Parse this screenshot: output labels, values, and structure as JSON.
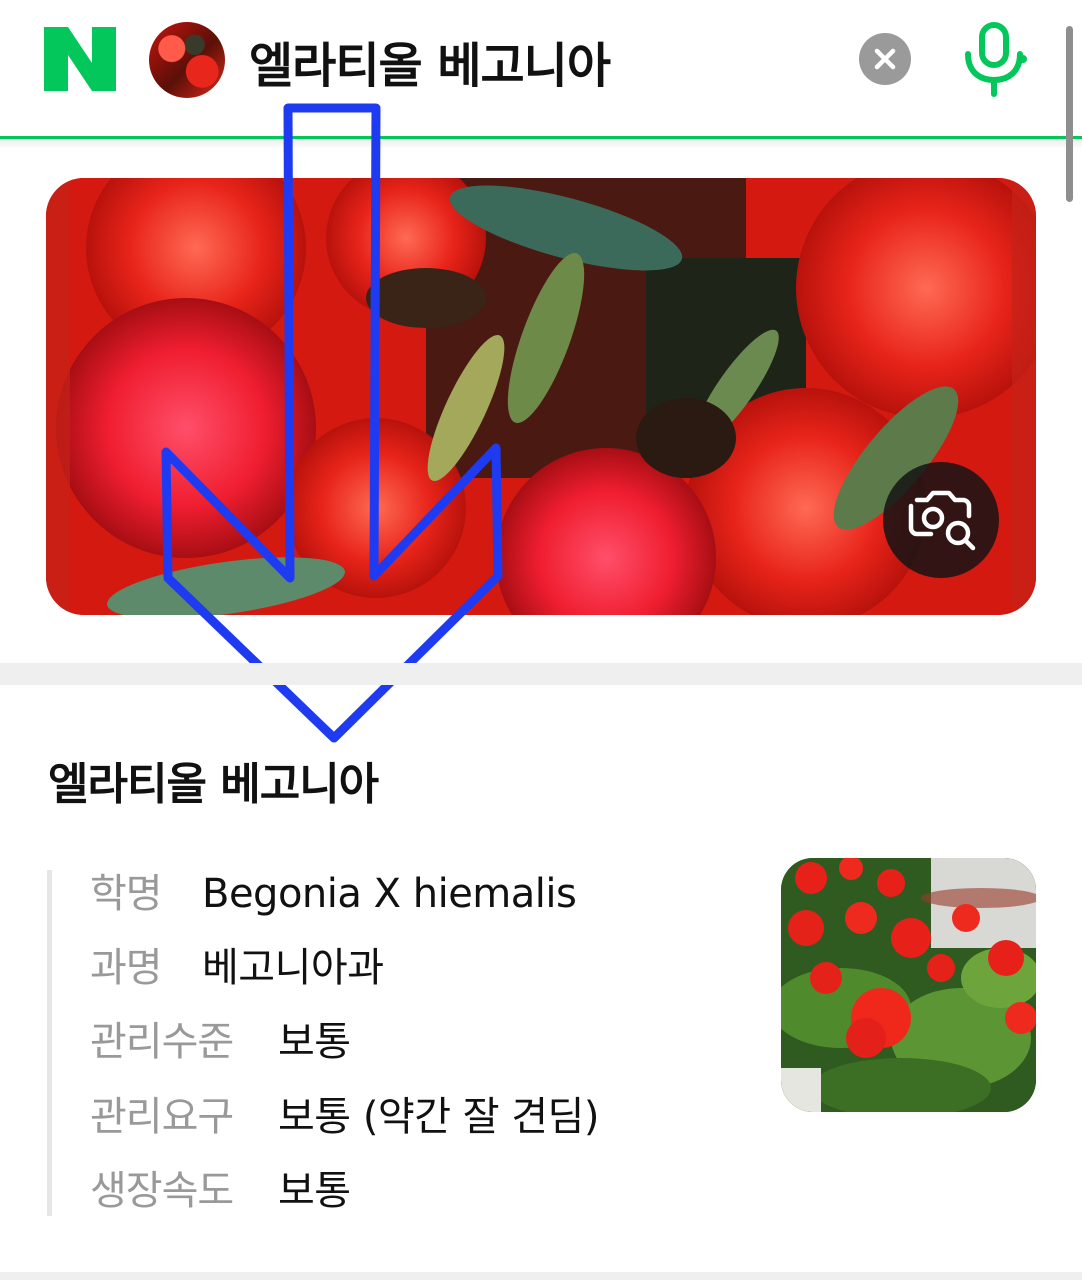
{
  "header": {
    "query": "엘라티올 베고니아",
    "logo": "naver-logo",
    "clear_icon": "close-icon",
    "voice_icon": "microphone-icon",
    "accent_color": "#03c75a"
  },
  "hero": {
    "lens_icon": "image-search-icon",
    "annotation": "blue-down-arrow",
    "annotation_color": "#1f3bf2"
  },
  "plant": {
    "name": "엘라티올 베고니아",
    "info": [
      {
        "key": "학명",
        "value": "Begonia X hiemalis"
      },
      {
        "key": "과명",
        "value": "베고니아과"
      },
      {
        "key": "관리수준",
        "value": "보통"
      },
      {
        "key": "관리요구",
        "value": "보통 (약간 잘 견딤)"
      },
      {
        "key": "생장속도",
        "value": "보통"
      }
    ]
  }
}
